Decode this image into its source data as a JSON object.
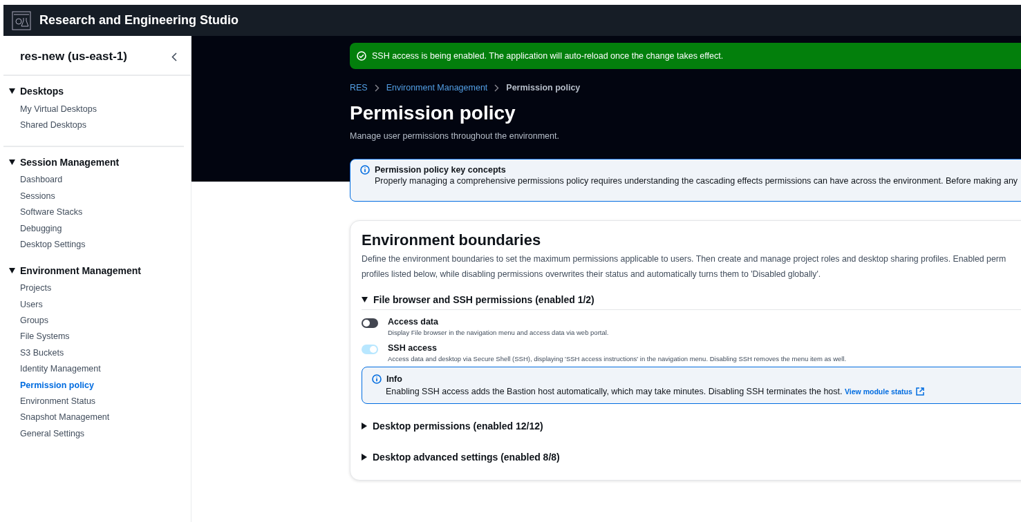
{
  "app": {
    "title": "Research and Engineering Studio"
  },
  "sidebar": {
    "title": "res-new (us-east-1)",
    "sections": [
      {
        "label": "Desktops",
        "expanded": true,
        "items": [
          {
            "label": "My Virtual Desktops",
            "selected": false
          },
          {
            "label": "Shared Desktops",
            "selected": false
          }
        ]
      },
      {
        "label": "Session Management",
        "expanded": true,
        "items": [
          {
            "label": "Dashboard",
            "selected": false
          },
          {
            "label": "Sessions",
            "selected": false
          },
          {
            "label": "Software Stacks",
            "selected": false
          },
          {
            "label": "Debugging",
            "selected": false
          },
          {
            "label": "Desktop Settings",
            "selected": false
          }
        ]
      },
      {
        "label": "Environment Management",
        "expanded": true,
        "items": [
          {
            "label": "Projects",
            "selected": false
          },
          {
            "label": "Users",
            "selected": false
          },
          {
            "label": "Groups",
            "selected": false
          },
          {
            "label": "File Systems",
            "selected": false
          },
          {
            "label": "S3 Buckets",
            "selected": false
          },
          {
            "label": "Identity Management",
            "selected": false
          },
          {
            "label": "Permission policy",
            "selected": true
          },
          {
            "label": "Environment Status",
            "selected": false
          },
          {
            "label": "Snapshot Management",
            "selected": false
          },
          {
            "label": "General Settings",
            "selected": false
          }
        ]
      }
    ]
  },
  "flash": {
    "message": "SSH access is being enabled. The application will auto-reload once the change takes effect."
  },
  "breadcrumbs": [
    {
      "label": "RES",
      "current": false
    },
    {
      "label": "Environment Management",
      "current": false
    },
    {
      "label": "Permission policy",
      "current": true
    }
  ],
  "page": {
    "title": "Permission policy",
    "description": "Manage user permissions throughout the environment."
  },
  "alert": {
    "title": "Permission policy key concepts",
    "text": "Properly managing a comprehensive permissions policy requires understanding the cascading effects permissions can have across the environment. Before making any"
  },
  "boundaries": {
    "title": "Environment boundaries",
    "description_lines": [
      "Define the environment boundaries to set the maximum permissions applicable to users. Then create and manage project roles and desktop sharing profiles. Enabled perm",
      "profiles listed below, while disabling permissions overwrites their status and automatically turns them to 'Disabled globally'."
    ],
    "sections": [
      {
        "title": "File browser and SSH permissions (enabled 1/2)",
        "expanded": true,
        "settings": [
          {
            "label": "Access data",
            "description": "Display File browser in the navigation menu and access data via web portal.",
            "on": false,
            "disabled": false
          },
          {
            "label": "SSH access",
            "description": "Access data and desktop via Secure Shell (SSH), displaying 'SSH access instructions' in the navigation menu. Disabling SSH removes the menu item as well.",
            "on": true,
            "disabled": true
          }
        ],
        "info": {
          "title": "Info",
          "text": "Enabling SSH access adds the Bastion host automatically, which may take minutes. Disabling SSH terminates the host.",
          "link": "View module status"
        }
      },
      {
        "title": "Desktop permissions (enabled 12/12)",
        "expanded": false
      },
      {
        "title": "Desktop advanced settings (enabled 8/8)",
        "expanded": false
      }
    ]
  }
}
